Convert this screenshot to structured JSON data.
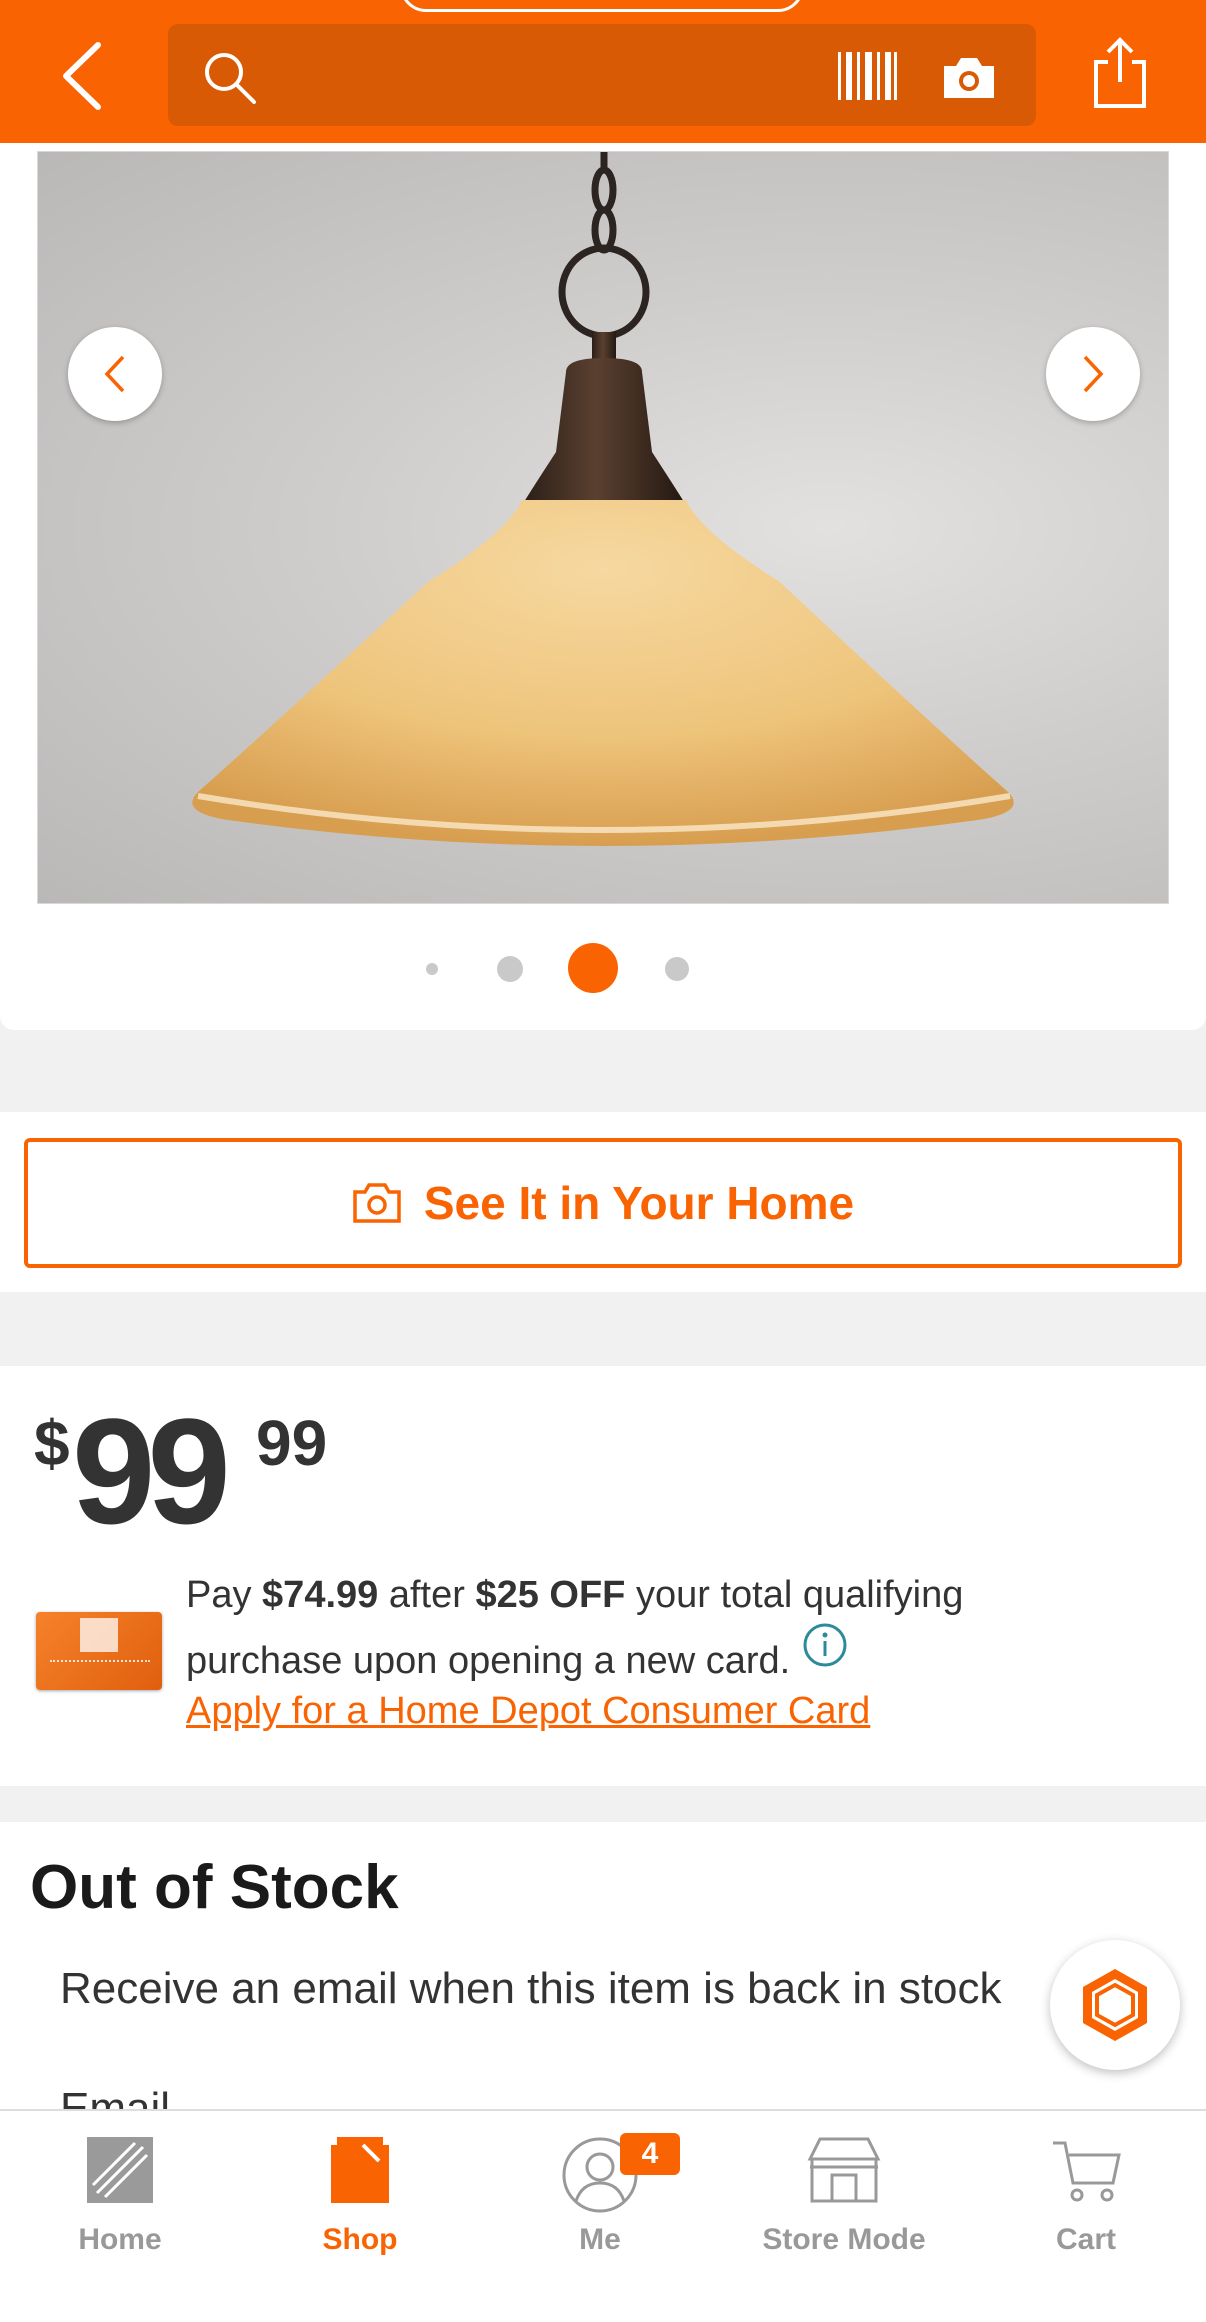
{
  "header": {
    "search_placeholder": "",
    "back_icon": "chevron-left-icon",
    "search_icon": "search-icon",
    "barcode_icon": "barcode-icon",
    "camera_icon": "camera-icon",
    "share_icon": "share-icon",
    "color": "#f96302"
  },
  "gallery": {
    "prev_icon": "chevron-left-icon",
    "next_icon": "chevron-right-icon",
    "image_count": 4,
    "active_index": 2
  },
  "see_in_home": {
    "label": "See It in Your Home",
    "icon": "camera-icon"
  },
  "price": {
    "currency": "$",
    "dollars": "99",
    "cents": "99"
  },
  "promo": {
    "text_pay": "Pay",
    "sale_price": "$74.99",
    "text_after": "after",
    "discount": "$25 OFF",
    "text_rest": "your total qualifying purchase upon opening a new card.",
    "link": "Apply for a Home Depot Consumer Card"
  },
  "stock": {
    "title": "Out of Stock",
    "message": "Receive an email when this item is back in stock",
    "email_label": "Email"
  },
  "tabbar": {
    "items": [
      {
        "label": "Home",
        "icon": "home-depot-logo-icon"
      },
      {
        "label": "Shop",
        "icon": "shop-icon"
      },
      {
        "label": "Me",
        "icon": "user-icon",
        "badge": "4"
      },
      {
        "label": "Store Mode",
        "icon": "store-icon"
      },
      {
        "label": "Cart",
        "icon": "cart-icon"
      }
    ],
    "active": "Shop"
  }
}
